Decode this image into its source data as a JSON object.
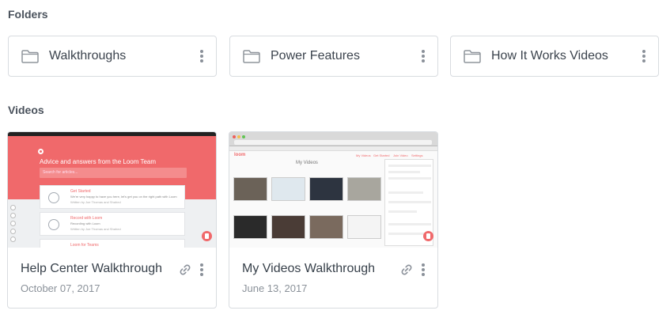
{
  "sections": {
    "folders_title": "Folders",
    "videos_title": "Videos"
  },
  "folders": [
    {
      "label": "Walkthroughs"
    },
    {
      "label": "Power Features"
    },
    {
      "label": "How It Works Videos"
    }
  ],
  "videos": [
    {
      "title": "Help Center Walkthrough",
      "date": "October 07, 2017",
      "thumbnail": {
        "heading": "Advice and answers from the Loom Team",
        "search_placeholder": "Search for articles...",
        "panels": [
          {
            "title": "Get Started",
            "line": "We're very happy to have you here, let's get you on the right path with Loom",
            "meta": "Written by Joe Thomas and Shahed"
          },
          {
            "title": "Record with Loom",
            "line": "Recording with Loom",
            "meta": "Written by Joe Thomas and Shahed"
          },
          {
            "title": "Loom for Teams",
            "line": "",
            "meta": ""
          }
        ]
      }
    },
    {
      "title": "My Videos Walkthrough",
      "date": "June 13, 2017",
      "thumbnail": {
        "brand": "loom",
        "heading": "My Videos",
        "nav": [
          "My Videos",
          "Get Started",
          "Join Video",
          "Settings"
        ]
      }
    }
  ],
  "colors": {
    "accent": "#f0696b",
    "border": "#d8dce0",
    "text": "#37404a",
    "muted": "#8b929a"
  },
  "icons": {
    "folder": "folder-icon",
    "more": "kebab-menu-icon",
    "link": "link-icon",
    "record": "record-icon"
  }
}
